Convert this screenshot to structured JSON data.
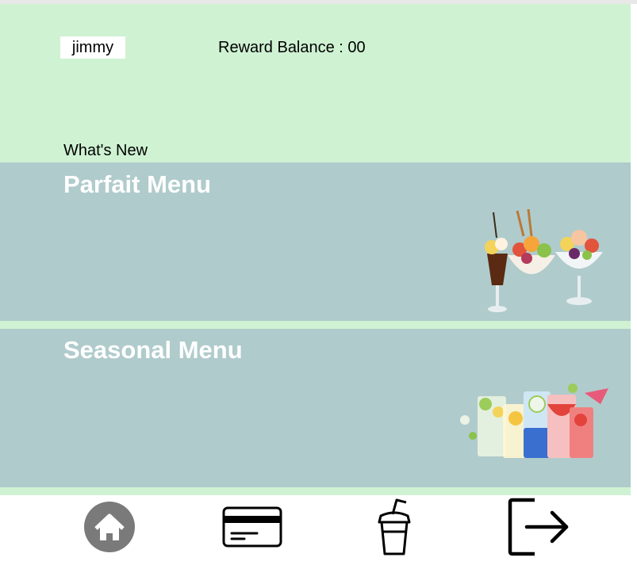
{
  "header": {
    "username": "jimmy",
    "reward_balance": "Reward Balance : 00",
    "whats_new": "What's New"
  },
  "menus": [
    {
      "title": "Parfait Menu",
      "image": "parfait-sundaes-image"
    },
    {
      "title": "Seasonal Menu",
      "image": "fruit-drinks-image"
    }
  ],
  "bottom_nav": [
    {
      "icon": "home-icon"
    },
    {
      "icon": "card-icon"
    },
    {
      "icon": "drink-cup-icon"
    },
    {
      "icon": "logout-icon"
    }
  ],
  "colors": {
    "header_bg": "#cff2d3",
    "card_bg": "#b0cbcc",
    "title_text": "#ffffff",
    "home_circle": "#7a7a7a"
  }
}
